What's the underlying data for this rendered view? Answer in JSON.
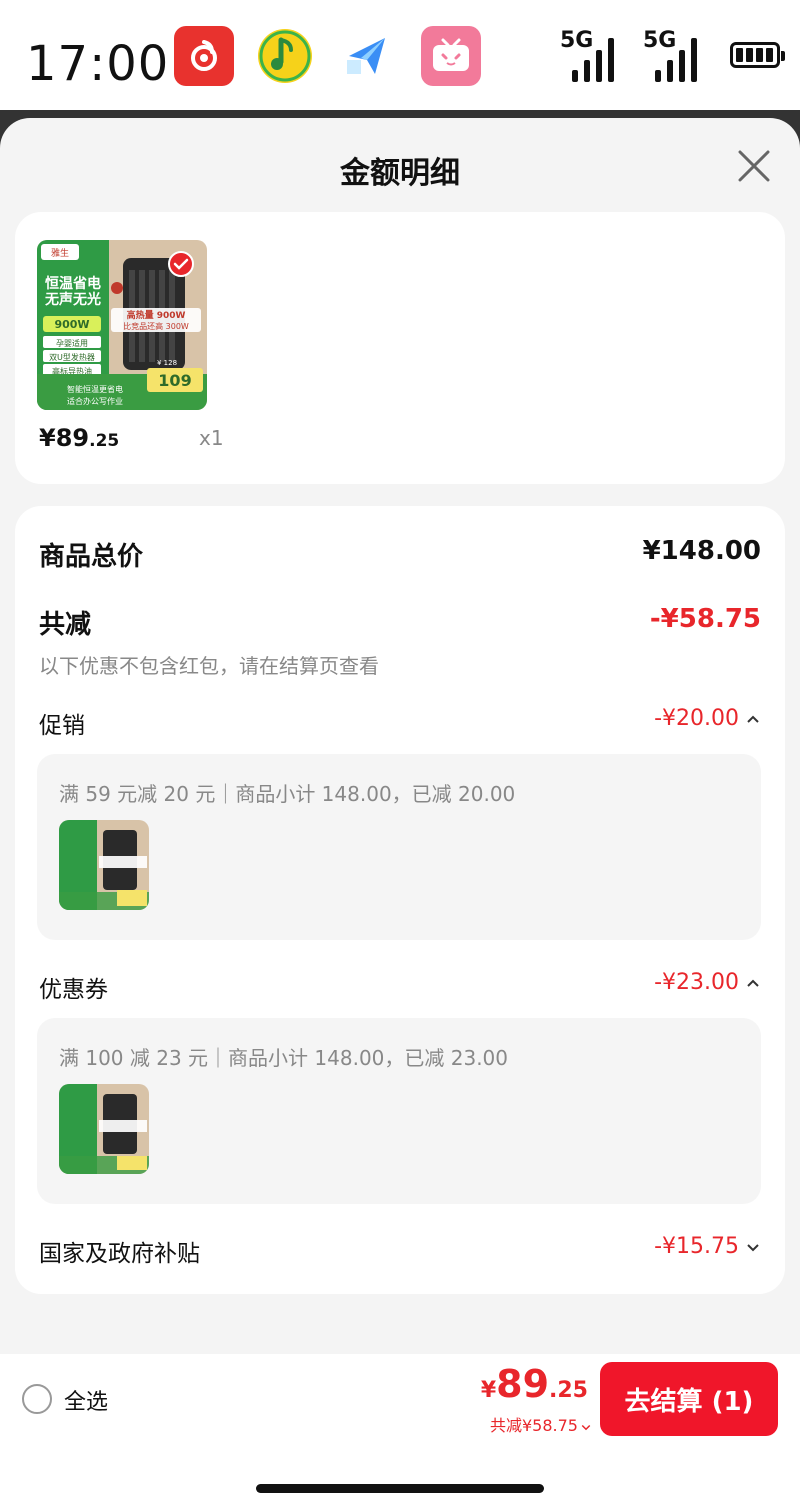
{
  "status_bar": {
    "time": "17:00",
    "apps": [
      "netease-music-icon",
      "qq-music-icon",
      "send-app-icon",
      "bilibili-icon"
    ],
    "signal1": "5G",
    "signal2": "5G"
  },
  "sheet": {
    "title": "金额明细"
  },
  "product": {
    "price_currency": "¥",
    "price_int": "89",
    "price_dec": ".25",
    "qty": "x1",
    "image_text": {
      "brand": "雅生",
      "tagline1": "恒温省电",
      "tagline2": "无声无光",
      "spec": "900W",
      "badge1": "孕婴适用",
      "badge2": "双U型发热器",
      "badge3": "高标导热油",
      "heat": "高热量 900W",
      "compare": "比竞品还高 300W",
      "price_tag": "109",
      "orig_price": "¥ 128",
      "bottom1": "智能恒温更省电",
      "bottom2": "适合办公写作业"
    }
  },
  "summary": {
    "total_label": "商品总价",
    "total_value": "¥148.00",
    "discount_label": "共减",
    "discount_value": "-¥58.75",
    "note": "以下优惠不包含红包，请在结算页查看",
    "promo_label": "促销",
    "promo_value": "-¥20.00",
    "promo_detail": "满 59 元减 20 元｜商品小计 148.00，已减 20.00",
    "coupon_label": "优惠券",
    "coupon_value": "-¥23.00",
    "coupon_detail": "满 100 减 23 元｜商品小计 148.00，已减 23.00",
    "subsidy_label": "国家及政府补贴",
    "subsidy_value": "-¥15.75"
  },
  "footer": {
    "select_all": "全选",
    "total_currency": "¥",
    "total_int": "89",
    "total_dec": ".25",
    "saved": "共减¥58.75",
    "checkout": "去结算 (1)"
  },
  "colors": {
    "accent_red": "#e8262b",
    "checkout_bg": "#f0162a"
  }
}
